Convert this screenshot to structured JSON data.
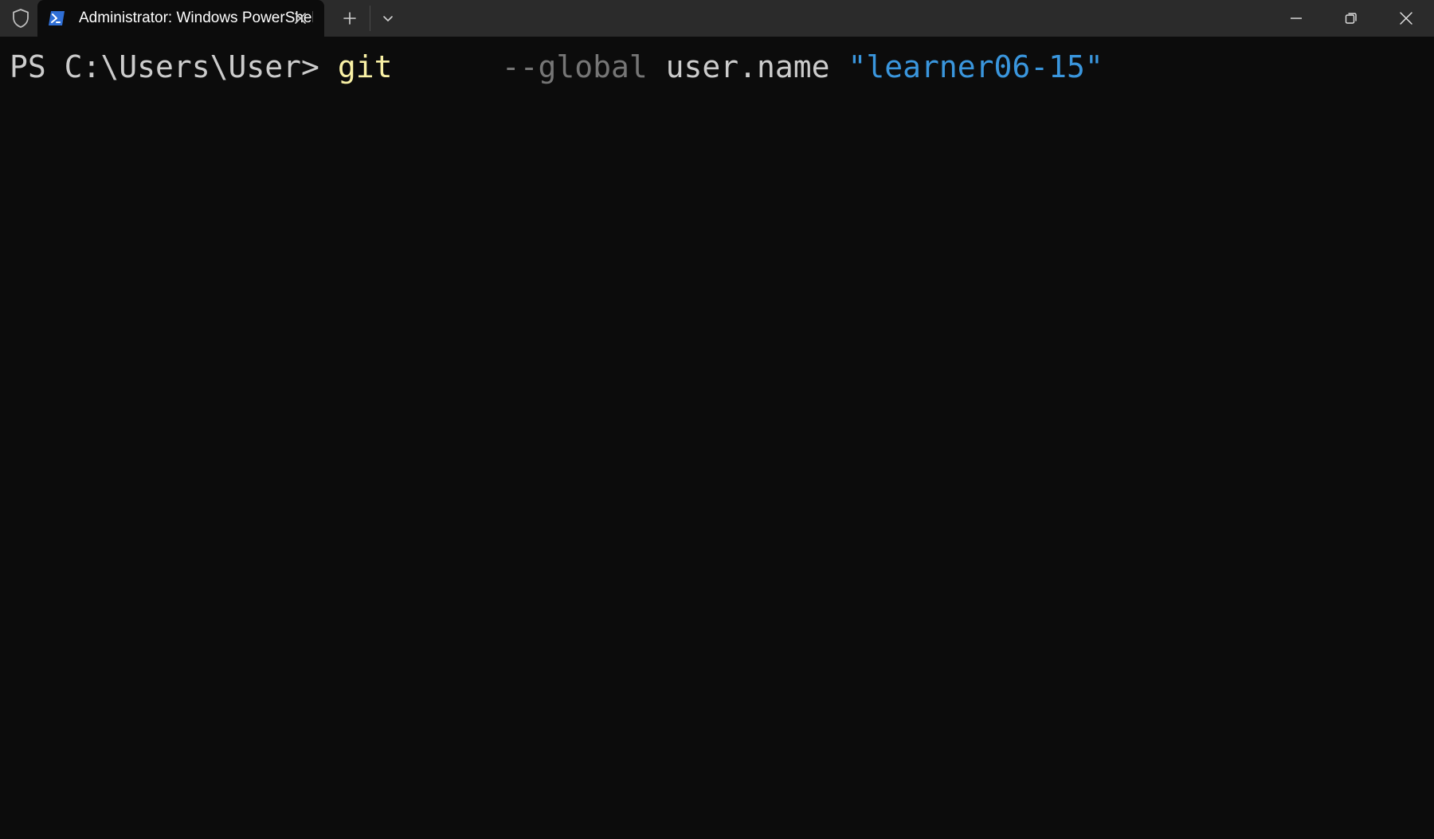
{
  "window": {
    "tab_title": "Administrator: Windows PowerShell",
    "icons": {
      "admin": "shield-icon",
      "tab": "powershell-icon",
      "tab_close": "close-icon",
      "new_tab": "plus-icon",
      "dropdown": "chevron-down-icon",
      "minimize": "minimize-icon",
      "maximize": "restore-icon",
      "close": "close-icon"
    }
  },
  "terminal": {
    "prompt": "PS C:\\Users\\User> ",
    "command": "git",
    "gap": "      ",
    "parameter": "--global",
    "argument": "user.name",
    "string": "\"learner06-15\""
  },
  "colors": {
    "background": "#0c0c0c",
    "titlebar": "#2b2b2b",
    "command": "#f9f1a5",
    "parameter": "#767676",
    "string": "#3a96dd",
    "text": "#cccccc"
  }
}
